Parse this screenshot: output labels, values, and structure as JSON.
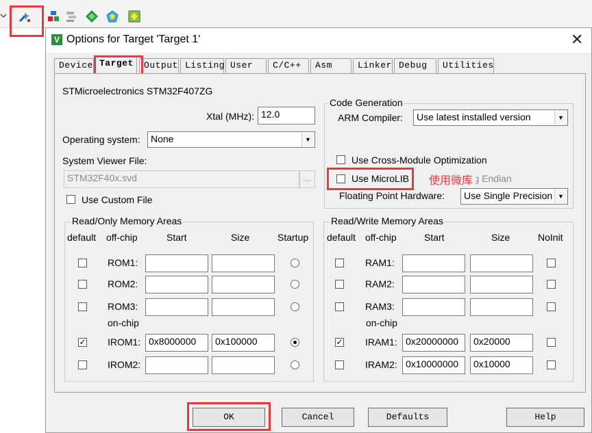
{
  "dialog": {
    "title": "Options for Target 'Target 1'",
    "close": "✕",
    "tabs": [
      "Device",
      "Target",
      "Output",
      "Listing",
      "User",
      "C/C++",
      "Asm",
      "Linker",
      "Debug",
      "Utilities"
    ],
    "active_tab": "Target"
  },
  "target": {
    "device": "STMicroelectronics STM32F407ZG",
    "xtal_label": "Xtal (MHz):",
    "xtal_value": "12.0",
    "os_label": "Operating system:",
    "os_value": "None",
    "svd_label": "System Viewer File:",
    "svd_value": "STM32F40x.svd",
    "browse": "...",
    "custom_file_label": "Use Custom File",
    "code_gen_title": "Code Generation",
    "compiler_label": "ARM Compiler:",
    "compiler_value": "Use latest installed version",
    "cross_module_label": "Use Cross-Module Optimization",
    "microlib_label": "Use MicroLIB",
    "big_endian_label": "Big Endian",
    "annotation": "使用微库",
    "fpu_label": "Floating Point Hardware:",
    "fpu_value": "Use Single Precision"
  },
  "ro_memory": {
    "title": "Read/Only Memory Areas",
    "headers": {
      "default": "default",
      "offchip": "off-chip",
      "start": "Start",
      "size": "Size",
      "startup": "Startup"
    },
    "onchip_label": "on-chip",
    "rows": [
      {
        "label": "ROM1:",
        "start": "",
        "size": "",
        "default": false,
        "startup": false
      },
      {
        "label": "ROM2:",
        "start": "",
        "size": "",
        "default": false,
        "startup": false
      },
      {
        "label": "ROM3:",
        "start": "",
        "size": "",
        "default": false,
        "startup": false
      },
      {
        "label": "IROM1:",
        "start": "0x8000000",
        "size": "0x100000",
        "default": true,
        "startup": true
      },
      {
        "label": "IROM2:",
        "start": "",
        "size": "",
        "default": false,
        "startup": false
      }
    ]
  },
  "rw_memory": {
    "title": "Read/Write Memory Areas",
    "headers": {
      "default": "default",
      "offchip": "off-chip",
      "start": "Start",
      "size": "Size",
      "noinit": "NoInit"
    },
    "onchip_label": "on-chip",
    "rows": [
      {
        "label": "RAM1:",
        "start": "",
        "size": "",
        "default": false,
        "noinit": false
      },
      {
        "label": "RAM2:",
        "start": "",
        "size": "",
        "default": false,
        "noinit": false
      },
      {
        "label": "RAM3:",
        "start": "",
        "size": "",
        "default": false,
        "noinit": false
      },
      {
        "label": "IRAM1:",
        "start": "0x20000000",
        "size": "0x20000",
        "default": true,
        "noinit": false
      },
      {
        "label": "IRAM2:",
        "start": "0x10000000",
        "size": "0x10000",
        "default": false,
        "noinit": false
      }
    ]
  },
  "buttons": {
    "ok": "OK",
    "cancel": "Cancel",
    "defaults": "Defaults",
    "help": "Help"
  },
  "colors": {
    "highlight": "#e8393b",
    "dialog_bg": "#f0f0f0"
  },
  "icons": [
    "options-for-target-icon",
    "load-icon",
    "manage-components-icon",
    "select-packs-icon",
    "batch-build-icon"
  ]
}
